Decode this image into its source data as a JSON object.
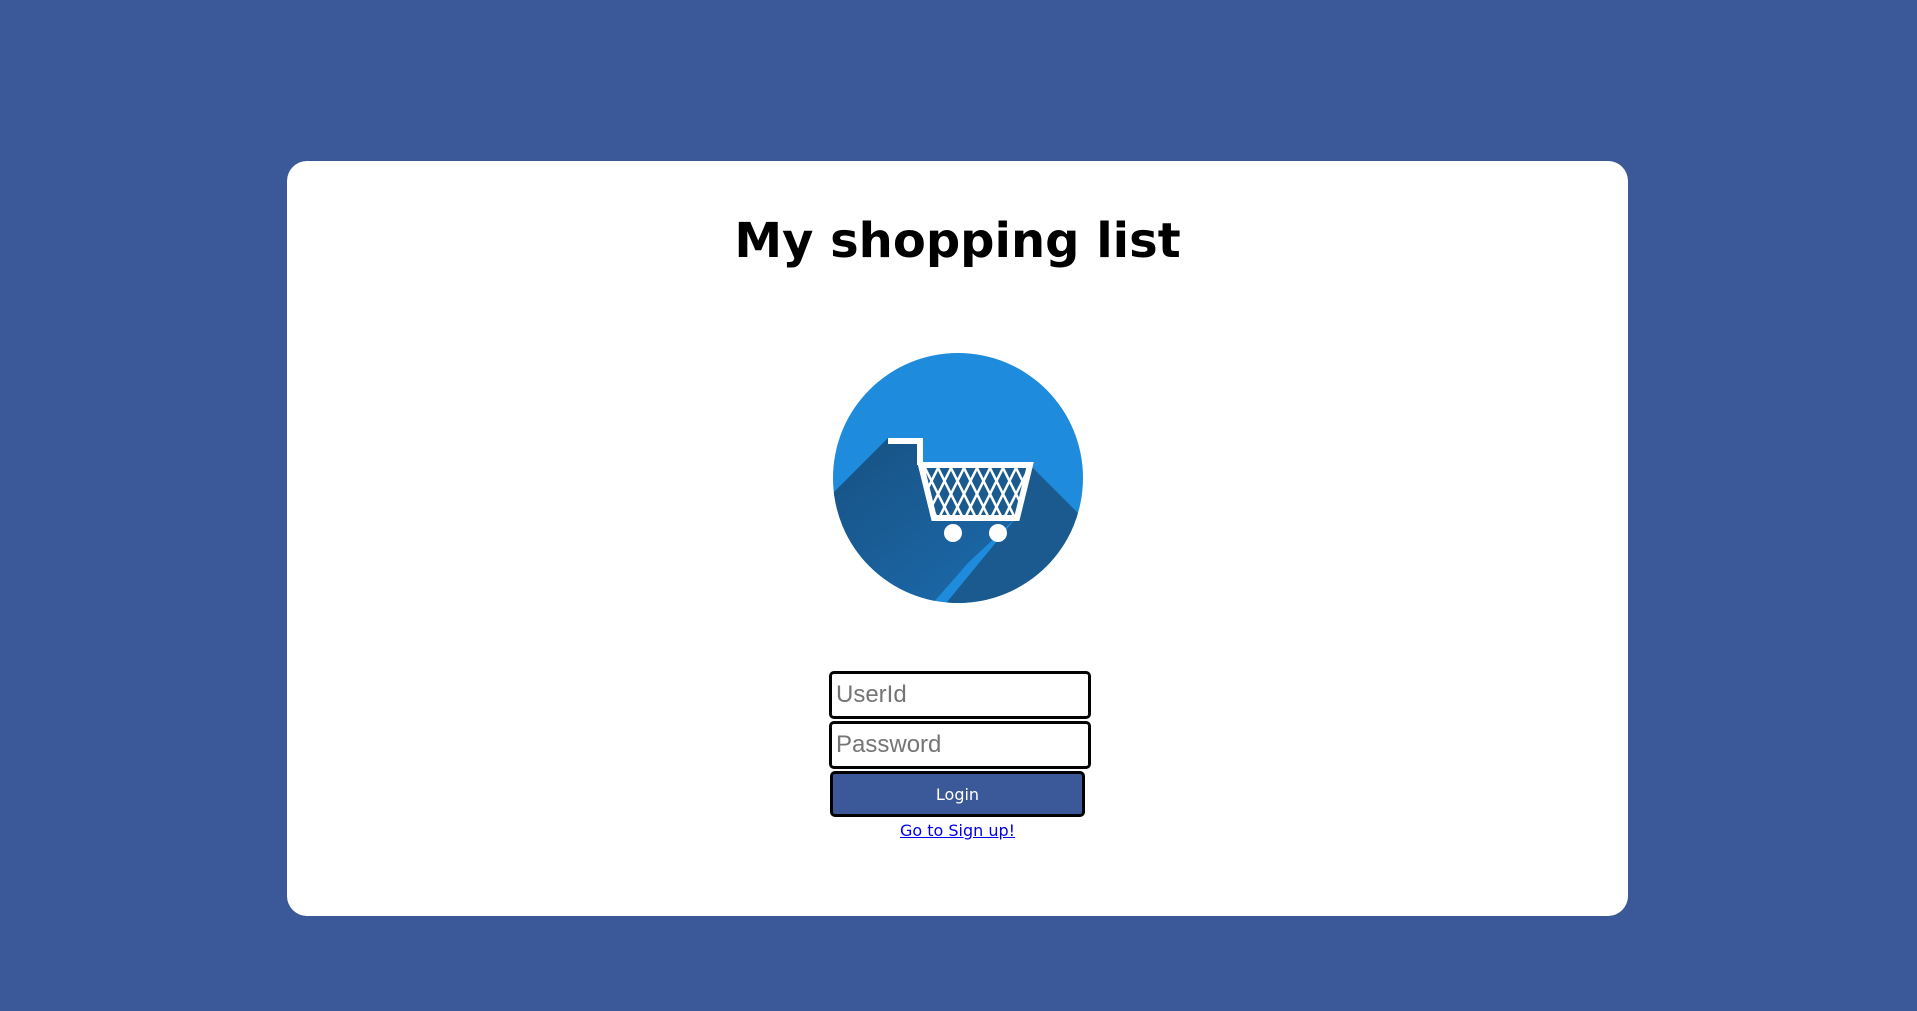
{
  "title": "My shopping list",
  "logo": {
    "icon": "shopping-cart-icon",
    "circle_color": "#1e8bdc",
    "shadow_color": "#1a5a8e"
  },
  "form": {
    "userid_placeholder": "UserId",
    "password_placeholder": "Password",
    "login_label": "Login",
    "signup_link": "Go to Sign up!"
  },
  "colors": {
    "background": "#3b5998",
    "button": "#3b5998",
    "link": "#0000ee"
  }
}
